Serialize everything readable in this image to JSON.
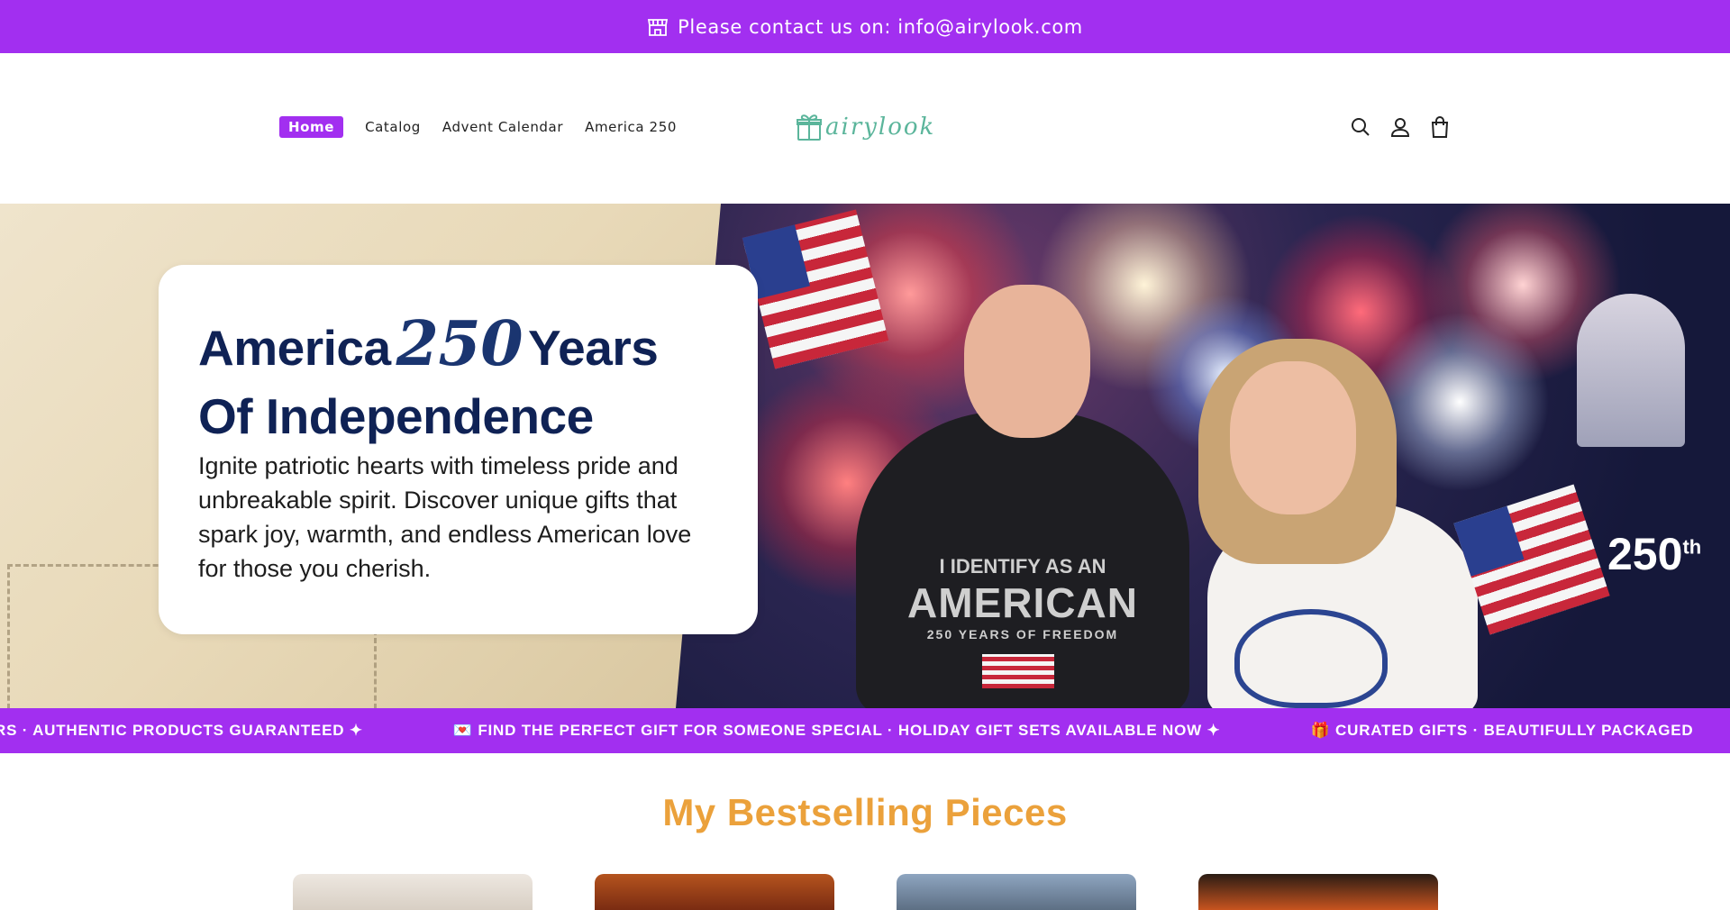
{
  "announcement": {
    "text": "Please contact us on: info@airylook.com",
    "icon": "store-icon",
    "bg_color": "#a22ff0"
  },
  "header": {
    "nav": [
      {
        "label": "Home",
        "active": true
      },
      {
        "label": "Catalog",
        "active": false
      },
      {
        "label": "Advent Calendar",
        "active": false
      },
      {
        "label": "America 250",
        "active": false
      }
    ],
    "logo": {
      "text": "airylook",
      "icon": "gift-box-icon"
    },
    "icons": [
      "search-icon",
      "account-icon",
      "cart-bag-icon"
    ]
  },
  "hero": {
    "headline_line1_a": "America",
    "headline_number": "250",
    "headline_line1_b": "Years",
    "headline_line2": "Of Independence",
    "body": "Ignite patriotic hearts with timeless pride and unbreakable spirit. Discover unique gifts that spark joy, warmth, and endless American love for those you cherish.",
    "shirt_line1": "I IDENTIFY AS AN",
    "shirt_line2": "AMERICAN",
    "shirt_line3": "250 YEARS OF FREEDOM",
    "badge_number": "250",
    "badge_suffix": "th"
  },
  "marquee": {
    "messages": [
      "RS · AUTHENTIC PRODUCTS GUARANTEED ✦",
      "💌 FIND THE PERFECT GIFT FOR SOMEONE SPECIAL · HOLIDAY GIFT SETS AVAILABLE NOW ✦",
      "🎁 CURATED GIFTS · BEAUTIFULLY PACKAGED"
    ]
  },
  "bestsellers": {
    "title": "My Bestselling Pieces"
  },
  "colors": {
    "accent": "#a22ff0",
    "title_orange": "#eba13b",
    "navy": "#0f2255",
    "logo_green": "#5bb59b"
  }
}
